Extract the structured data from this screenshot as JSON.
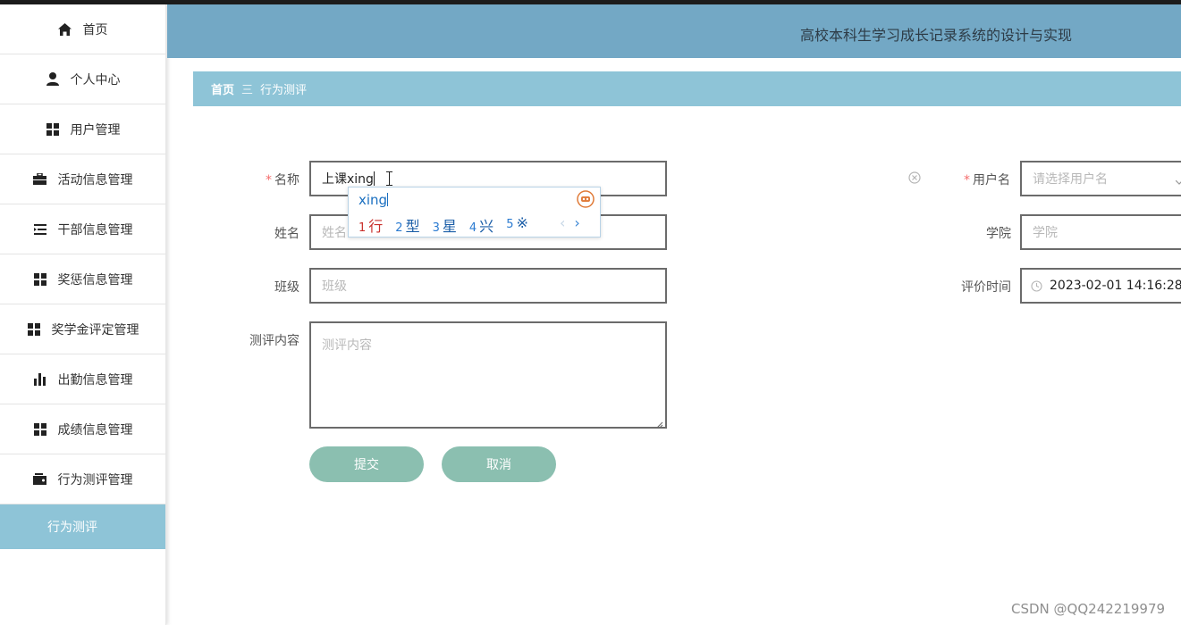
{
  "header": {
    "title": "高校本科生学习成长记录系统的设计与实现"
  },
  "sidebar": {
    "items": [
      {
        "label": "首页",
        "icon": "home-icon"
      },
      {
        "label": "个人中心",
        "icon": "user-icon"
      },
      {
        "label": "用户管理",
        "icon": "grid-icon"
      },
      {
        "label": "活动信息管理",
        "icon": "briefcase-icon"
      },
      {
        "label": "干部信息管理",
        "icon": "list-icon"
      },
      {
        "label": "奖惩信息管理",
        "icon": "grid-icon"
      },
      {
        "label": "奖学金评定管理",
        "icon": "grid-icon"
      },
      {
        "label": "出勤信息管理",
        "icon": "bar-chart-icon"
      },
      {
        "label": "成绩信息管理",
        "icon": "grid-icon"
      },
      {
        "label": "行为测评管理",
        "icon": "wallet-icon"
      },
      {
        "label": "行为测评",
        "icon": ""
      }
    ]
  },
  "breadcrumb": {
    "home": "首页",
    "separator": "三",
    "current": "行为测评"
  },
  "form": {
    "name_label": "名称",
    "name_value": "上课xing",
    "username_label": "用户名",
    "username_placeholder": "请选择用户名",
    "realname_label": "姓名",
    "realname_placeholder": "姓名",
    "college_label": "学院",
    "college_placeholder": "学院",
    "class_label": "班级",
    "class_placeholder": "班级",
    "eval_time_label": "评价时间",
    "eval_time_value": "2023-02-01 14:16:28",
    "content_label": "测评内容",
    "content_placeholder": "测评内容",
    "required_mark": "*"
  },
  "buttons": {
    "submit": "提交",
    "cancel": "取消"
  },
  "ime": {
    "pinyin": "xing",
    "candidates": [
      {
        "num": "1",
        "char": "行"
      },
      {
        "num": "2",
        "char": "型"
      },
      {
        "num": "3",
        "char": "星"
      },
      {
        "num": "4",
        "char": "兴"
      },
      {
        "num": "5",
        "char": "※"
      }
    ],
    "prev": "‹",
    "next": "›"
  },
  "watermark": "CSDN @QQ242219979",
  "colors": {
    "header": "#73a8c5",
    "breadcrumb": "#8ec4d7",
    "active_nav": "#8ec4d7",
    "button": "#8bbfb0",
    "required": "#f56c6c"
  }
}
